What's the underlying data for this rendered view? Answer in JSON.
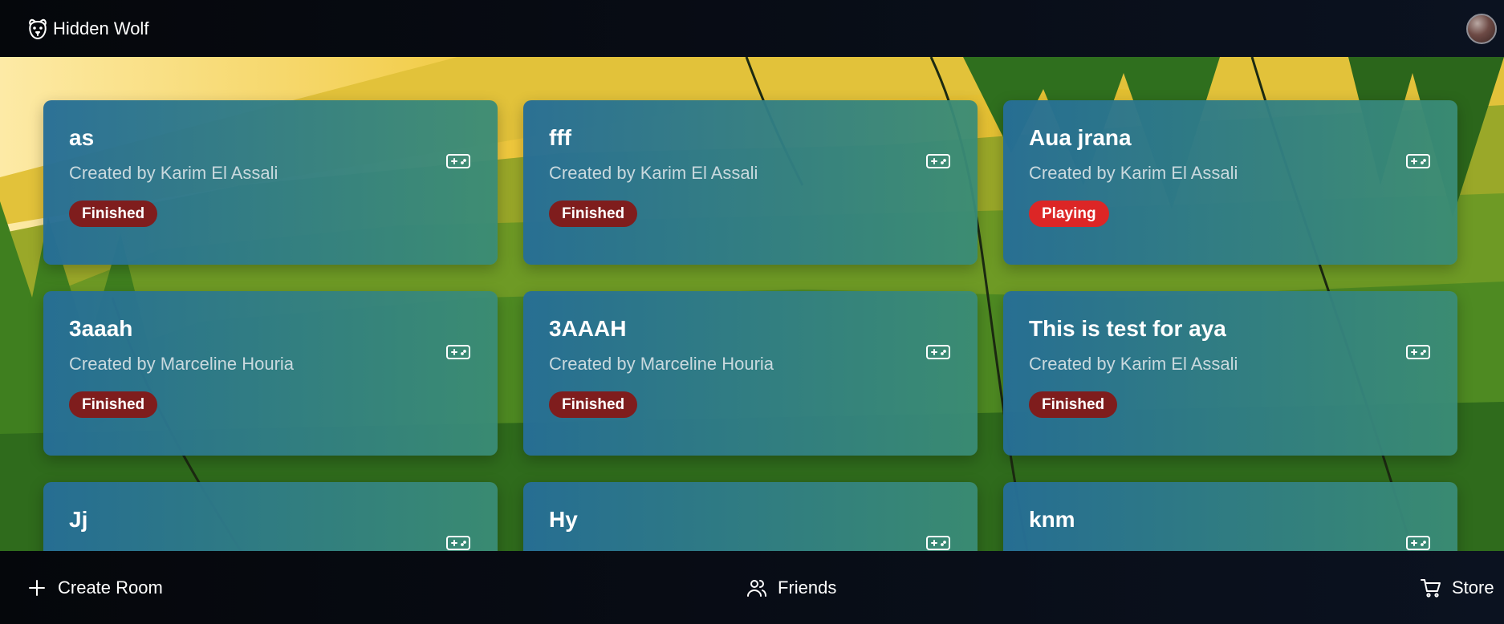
{
  "app": {
    "name": "Hidden Wolf",
    "logo_icon": "dog-face-icon",
    "avatar_icon": "user-avatar"
  },
  "rooms": [
    {
      "title": "as",
      "creator": "Created by Karim El Assali",
      "status": "Finished",
      "status_type": "finished",
      "icon": "gamepad-icon"
    },
    {
      "title": "fff",
      "creator": "Created by Karim El Assali",
      "status": "Finished",
      "status_type": "finished",
      "icon": "gamepad-icon"
    },
    {
      "title": "Aua jrana",
      "creator": "Created by Karim El Assali",
      "status": "Playing",
      "status_type": "playing",
      "icon": "gamepad-icon"
    },
    {
      "title": "3aaah",
      "creator": "Created by Marceline Houria",
      "status": "Finished",
      "status_type": "finished",
      "icon": "gamepad-icon"
    },
    {
      "title": "3AAAH",
      "creator": "Created by Marceline Houria",
      "status": "Finished",
      "status_type": "finished",
      "icon": "gamepad-icon"
    },
    {
      "title": "This is test for aya",
      "creator": "Created by Karim El Assali",
      "status": "Finished",
      "status_type": "finished",
      "icon": "gamepad-icon"
    },
    {
      "title": "Jj",
      "creator": "",
      "status": "",
      "status_type": "",
      "icon": "gamepad-icon"
    },
    {
      "title": "Hy",
      "creator": "",
      "status": "",
      "status_type": "",
      "icon": "gamepad-icon"
    },
    {
      "title": "knm",
      "creator": "",
      "status": "",
      "status_type": "",
      "icon": "gamepad-icon"
    }
  ],
  "nav": {
    "create_room": {
      "label": "Create Room",
      "icon": "plus-icon"
    },
    "friends": {
      "label": "Friends",
      "icon": "users-icon"
    },
    "store": {
      "label": "Store",
      "icon": "cart-icon"
    }
  },
  "colors": {
    "finished": "#7f1d1d",
    "playing": "#dc2626",
    "card_start": "#266e96",
    "card_end": "#3a8c76"
  }
}
